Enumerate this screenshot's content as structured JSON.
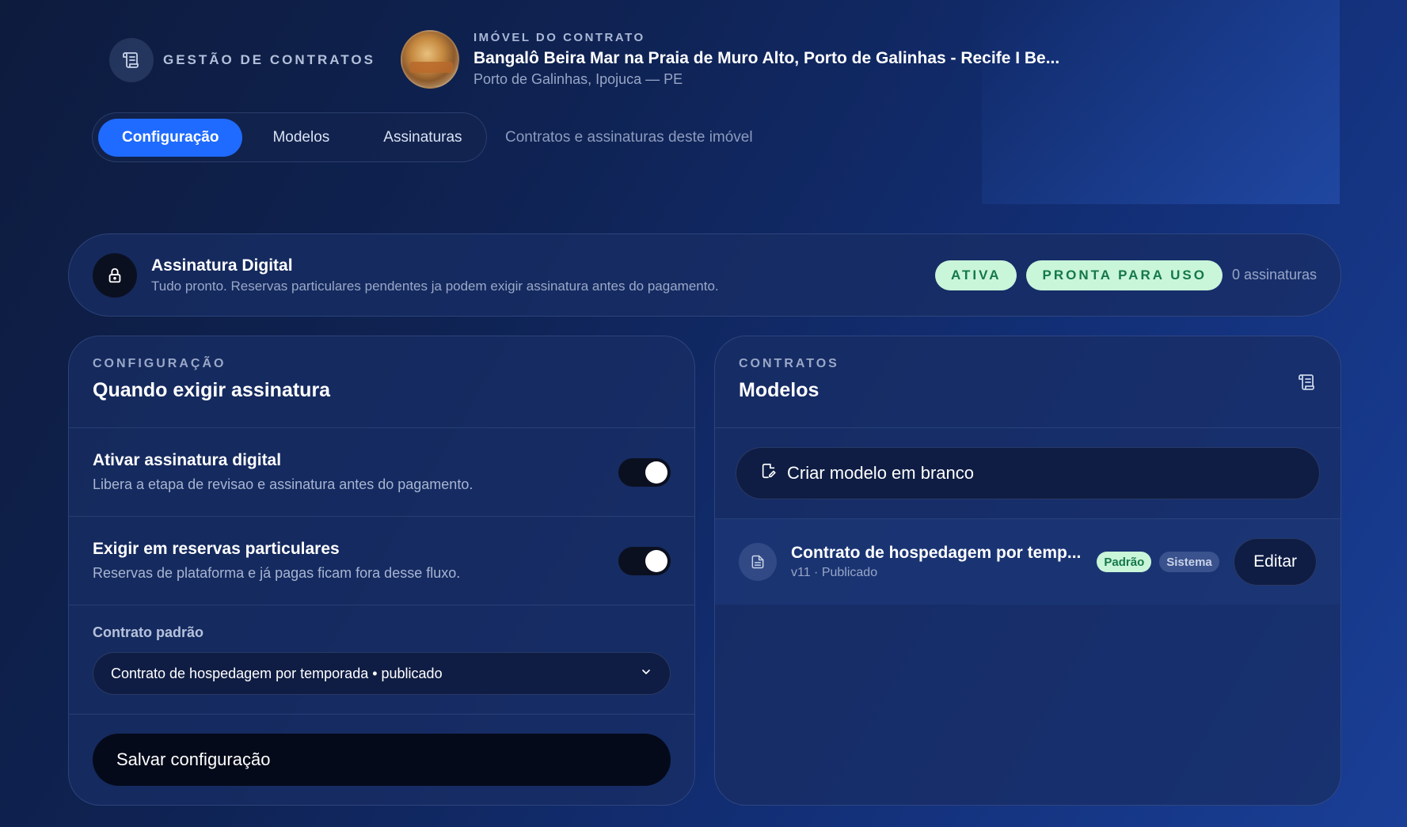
{
  "header": {
    "brand_label": "GESTÃO DE CONTRATOS",
    "brand_icon": "scroll-icon",
    "property_kicker": "IMÓVEL DO CONTRATO",
    "property_title": "Bangalô Beira Mar na Praia de Muro Alto, Porto de Galinhas - Recife I Be...",
    "property_location": "Porto de Galinhas, Ipojuca — PE"
  },
  "tabs": {
    "items": [
      {
        "label": "Configuração",
        "active": true
      },
      {
        "label": "Modelos",
        "active": false
      },
      {
        "label": "Assinaturas",
        "active": false
      }
    ],
    "hint": "Contratos e assinaturas deste imóvel"
  },
  "status": {
    "icon": "lock-icon",
    "title": "Assinatura Digital",
    "description": "Tudo pronto. Reservas particulares pendentes ja podem exigir assinatura antes do pagamento.",
    "badge_active": "ATIVA",
    "badge_ready": "PRONTA PARA USO",
    "count": "0 assinaturas"
  },
  "config": {
    "kicker": "CONFIGURAÇÃO",
    "title": "Quando exigir assinatura",
    "enable": {
      "title": "Ativar assinatura digital",
      "description": "Libera a etapa de revisao e assinatura antes do pagamento.",
      "on": true
    },
    "private": {
      "title": "Exigir em reservas particulares",
      "description": "Reservas de plataforma e já pagas ficam fora desse fluxo.",
      "on": true
    },
    "default_contract_label": "Contrato padrão",
    "default_contract_value": "Contrato de hospedagem por temporada • publicado",
    "save_label": "Salvar configuração"
  },
  "models": {
    "kicker": "CONTRATOS",
    "title": "Modelos",
    "header_icon": "scroll-icon",
    "create_label": "Criar modelo em branco",
    "items": [
      {
        "title": "Contrato de hospedagem por temp...",
        "meta": "v11 · Publicado",
        "badge_default": "Padrão",
        "badge_system": "Sistema",
        "edit_label": "Editar"
      }
    ]
  },
  "colors": {
    "accent": "#1f6bff",
    "success_bg": "#c9f5d9",
    "success_fg": "#14784a"
  }
}
